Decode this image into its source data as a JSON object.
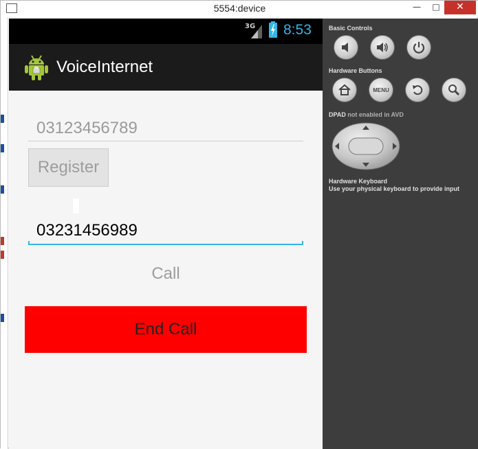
{
  "window": {
    "title": "5554:device",
    "minimize_glyph": "—",
    "maximize_glyph": "□",
    "close_glyph": "✕"
  },
  "status_bar": {
    "network": "3G",
    "time": "8:53",
    "accent_color": "#33b5e5"
  },
  "action_bar": {
    "app_title": "VoiceInternet",
    "icon": "android-icon"
  },
  "form": {
    "register_number": "03123456789",
    "register_label": "Register",
    "call_number": "03231456989",
    "call_label": "Call",
    "end_call_label": "End Call",
    "end_call_color": "#ff0000"
  },
  "emulator_controls": {
    "basic_controls_heading": "Basic Controls",
    "basic_buttons": [
      "volume-down-icon",
      "volume-up-icon",
      "power-icon"
    ],
    "hardware_buttons_heading": "Hardware Buttons",
    "hardware_buttons": [
      "home-icon",
      "menu-button",
      "back-icon",
      "search-icon"
    ],
    "menu_label": "MENU",
    "dpad_heading": "DPAD",
    "dpad_note": "not enabled in AVD",
    "keyboard_heading": "Hardware Keyboard",
    "keyboard_note": "Use your physical keyboard to provide input"
  }
}
